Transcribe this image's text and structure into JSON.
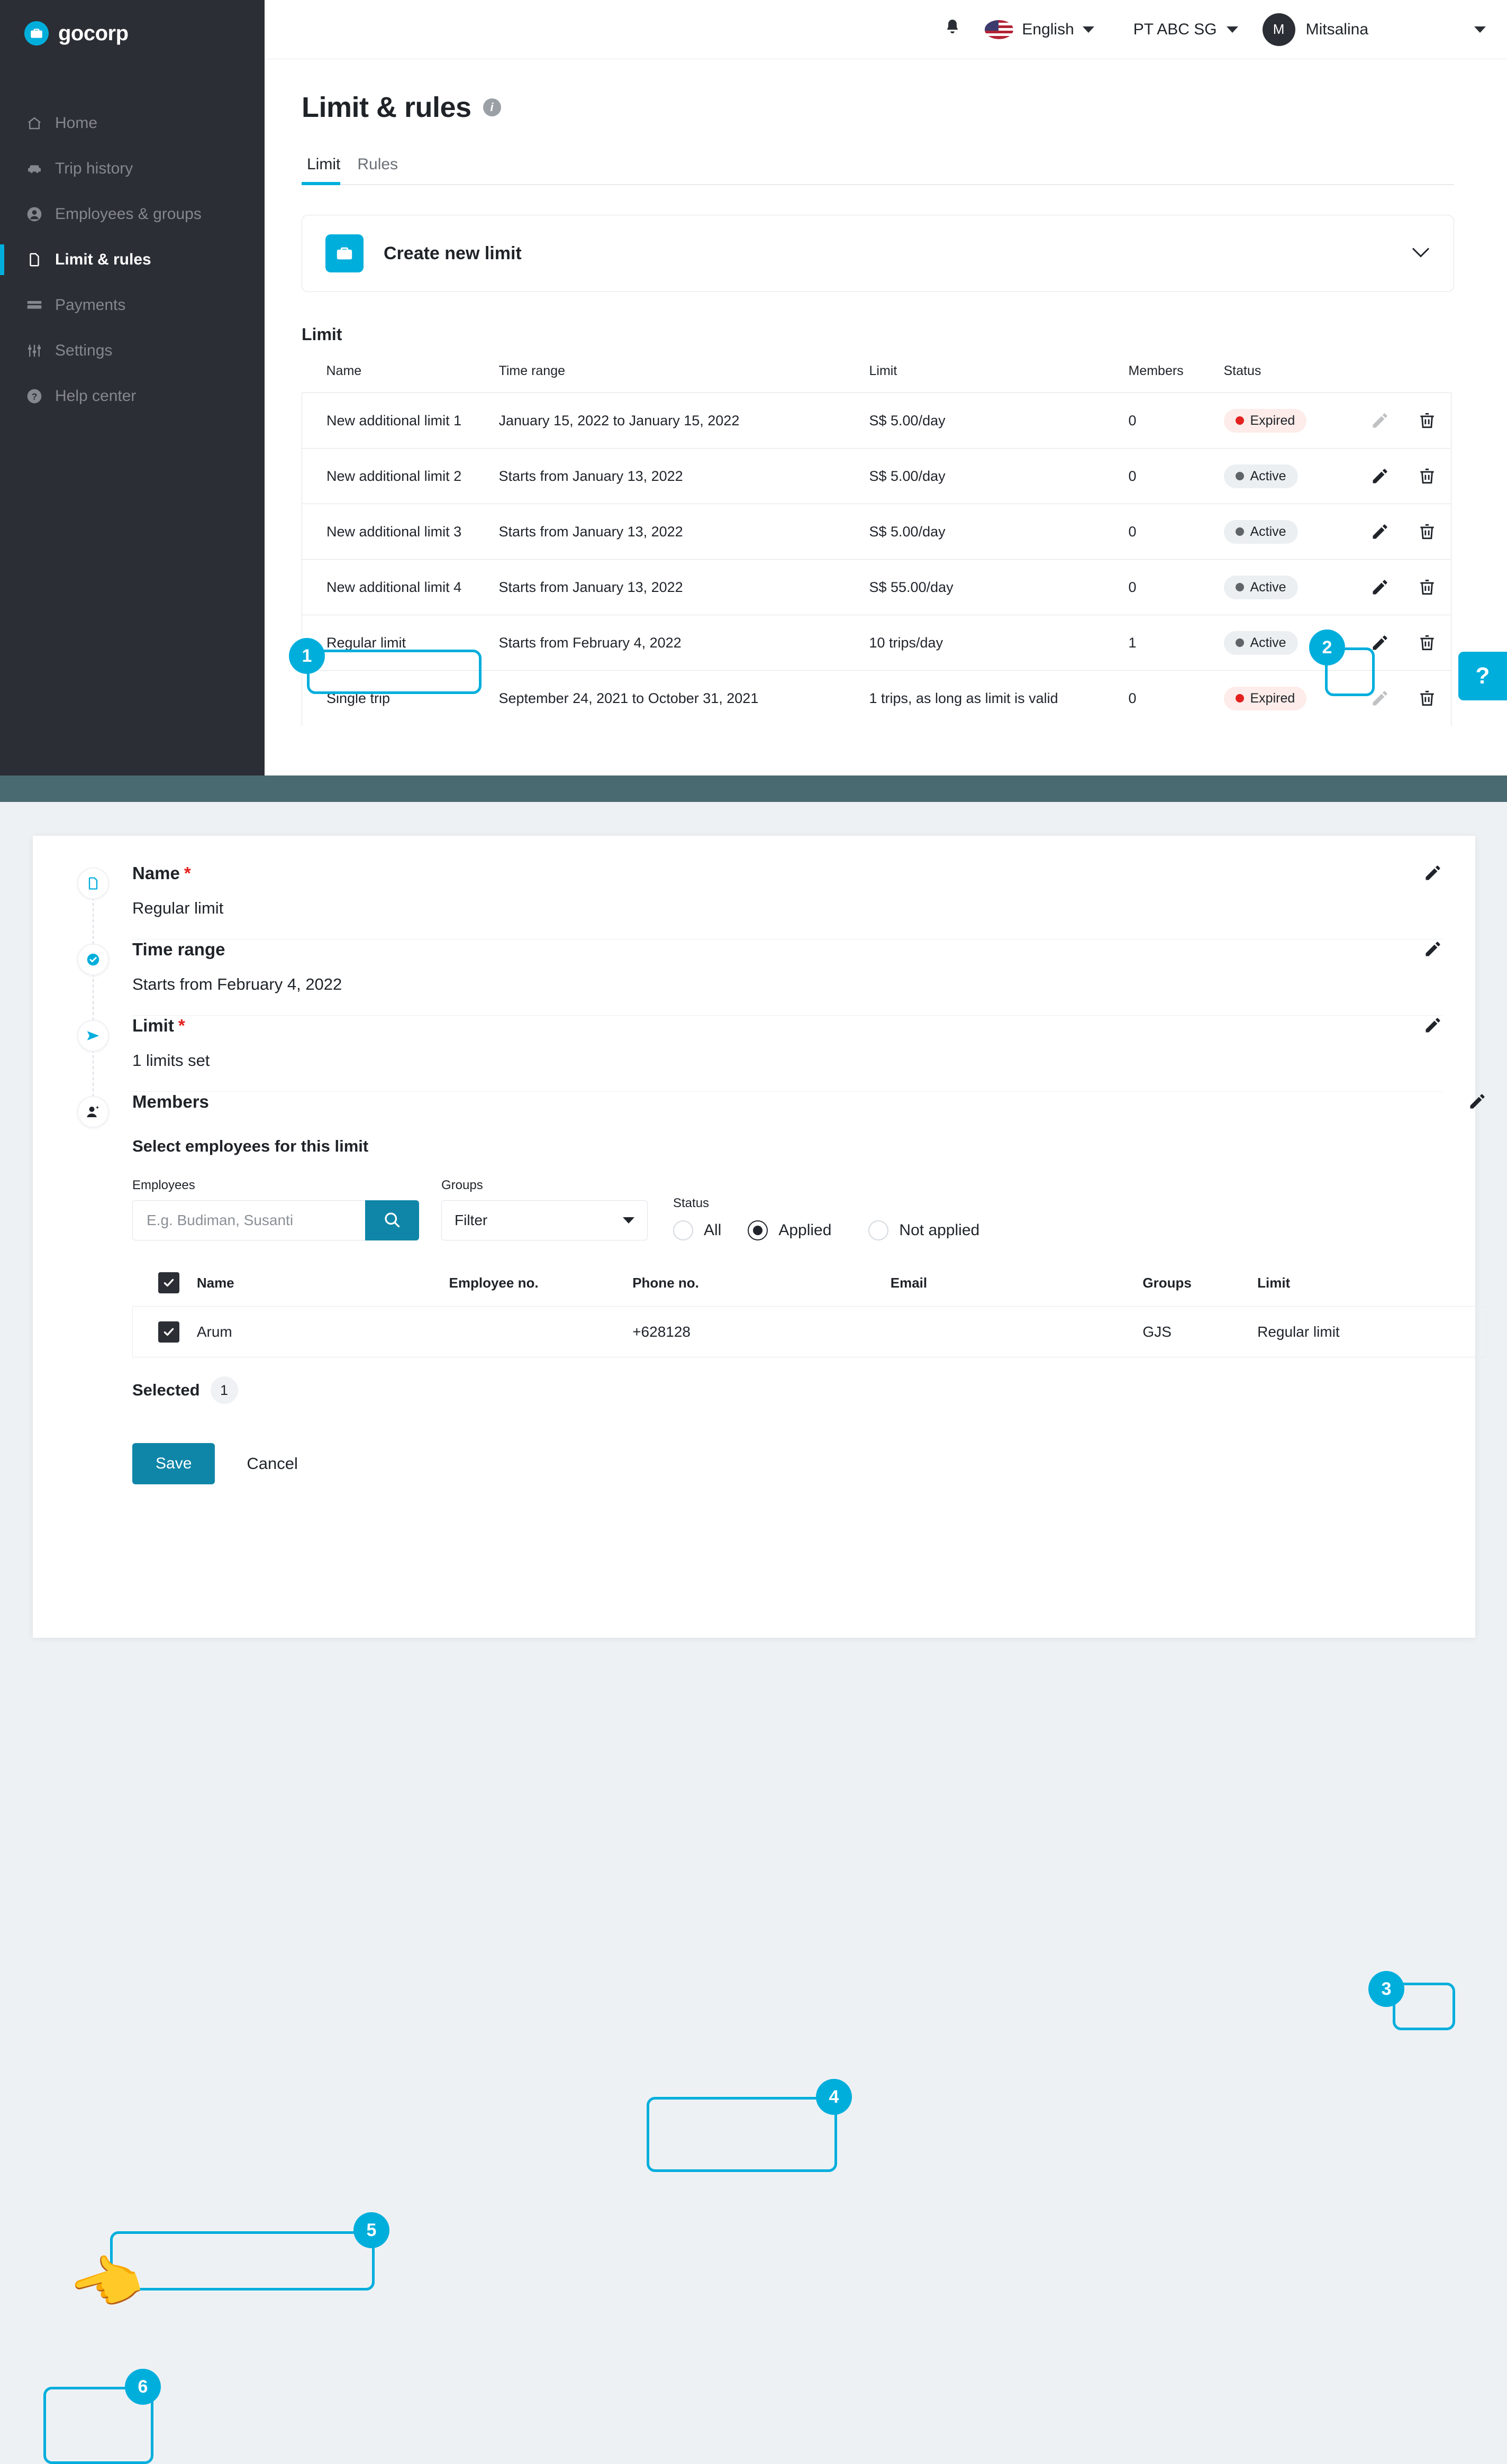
{
  "brand": {
    "name": "gocorp",
    "logo_icon": "briefcase-icon"
  },
  "sidebar": {
    "items": [
      {
        "label": "Home",
        "icon": "home-icon",
        "active": false
      },
      {
        "label": "Trip history",
        "icon": "car-icon",
        "active": false
      },
      {
        "label": "Employees & groups",
        "icon": "user-circle-icon",
        "active": false
      },
      {
        "label": "Limit & rules",
        "icon": "document-icon",
        "active": true
      },
      {
        "label": "Payments",
        "icon": "card-icon",
        "active": false
      },
      {
        "label": "Settings",
        "icon": "sliders-icon",
        "active": false
      },
      {
        "label": "Help center",
        "icon": "question-circle-icon",
        "active": false
      }
    ]
  },
  "topbar": {
    "bell_icon": "bell-icon",
    "language": "English",
    "flag_icon": "us-flag-icon",
    "organization": "PT ABC SG",
    "user_initial": "M",
    "user_name": "Mitsalina"
  },
  "page": {
    "title": "Limit & rules",
    "info_icon": "info-icon",
    "tabs": [
      {
        "label": "Limit",
        "active": true
      },
      {
        "label": "Rules",
        "active": false
      }
    ],
    "create_card": {
      "label": "Create new limit",
      "icon": "briefcase-icon",
      "chevron": "chevron-down-icon"
    },
    "section_label": "Limit"
  },
  "limit_table": {
    "columns": [
      "Name",
      "Time range",
      "Limit",
      "Members",
      "Status"
    ],
    "rows": [
      {
        "name": "New additional limit 1",
        "time_range": "January 15, 2022 to January 15, 2022",
        "limit": "S$ 5.00/day",
        "members": "0",
        "status": "Expired",
        "status_kind": "expired",
        "edit_enabled": false
      },
      {
        "name": "New additional limit 2",
        "time_range": "Starts from January 13, 2022",
        "limit": "S$ 5.00/day",
        "members": "0",
        "status": "Active",
        "status_kind": "active",
        "edit_enabled": true
      },
      {
        "name": "New additional limit 3",
        "time_range": "Starts from January 13, 2022",
        "limit": "S$ 5.00/day",
        "members": "0",
        "status": "Active",
        "status_kind": "active",
        "edit_enabled": true
      },
      {
        "name": "New additional limit 4",
        "time_range": "Starts from January 13, 2022",
        "limit": "S$ 55.00/day",
        "members": "0",
        "status": "Active",
        "status_kind": "active",
        "edit_enabled": true
      },
      {
        "name": "Regular limit",
        "time_range": "Starts from February 4, 2022",
        "limit": "10 trips/day",
        "members": "1",
        "status": "Active",
        "status_kind": "active",
        "edit_enabled": true
      },
      {
        "name": "Single trip",
        "time_range": "September 24, 2021 to October 31, 2021",
        "limit": "1 trips, as long as limit is valid",
        "members": "0",
        "status": "Expired",
        "status_kind": "expired",
        "edit_enabled": false
      }
    ]
  },
  "help_fab": {
    "label": "?"
  },
  "detail": {
    "steps": [
      {
        "title": "Name",
        "required": true,
        "value": "Regular limit",
        "icon": "document-icon",
        "edit_icon": "pencil-icon"
      },
      {
        "title": "Time range",
        "required": false,
        "value": "Starts from February 4, 2022",
        "icon": "check-badge-icon",
        "edit_icon": "pencil-icon"
      },
      {
        "title": "Limit",
        "required": true,
        "value": "1 limits set",
        "icon": "send-icon",
        "edit_icon": "pencil-icon"
      },
      {
        "title": "Members",
        "required": false,
        "value": "",
        "icon": "add-user-icon",
        "edit_icon": "pencil-icon"
      }
    ],
    "members_subtitle": "Select employees for this limit",
    "filters": {
      "employees_label": "Employees",
      "employees_placeholder": "E.g. Budiman, Susanti",
      "employees_value": "",
      "search_icon": "search-icon",
      "groups_label": "Groups",
      "groups_value": "Filter",
      "status_label": "Status",
      "status_options": [
        {
          "label": "All",
          "selected": false
        },
        {
          "label": "Applied",
          "selected": true
        },
        {
          "label": "Not applied",
          "selected": false
        }
      ]
    },
    "employee_table": {
      "columns": [
        "Name",
        "Employee no.",
        "Phone no.",
        "Email",
        "Groups",
        "Limit"
      ],
      "header_checked": true,
      "rows": [
        {
          "checked": true,
          "name": "Arum",
          "employee_no": "",
          "phone_no": "+628128",
          "email": "",
          "groups": "GJS",
          "limit": "Regular limit"
        }
      ]
    },
    "selected_label": "Selected",
    "selected_count": "1",
    "save_label": "Save",
    "cancel_label": "Cancel"
  },
  "callouts": [
    {
      "number": "1",
      "target": "limit-row-name-regular-limit"
    },
    {
      "number": "2",
      "target": "limit-row-edit-regular-limit"
    },
    {
      "number": "3",
      "target": "members-edit-button"
    },
    {
      "number": "4",
      "target": "status-filter-group"
    },
    {
      "number": "5",
      "target": "employee-row-arum"
    },
    {
      "number": "6",
      "target": "save-button"
    }
  ],
  "colors": {
    "accent": "#00AEDC",
    "accent_dark": "#0f86a8",
    "sidebar_bg": "#2b2e34",
    "status_expired": "#e3211e",
    "status_active": "#5f6469",
    "strip": "#4a6a71"
  }
}
